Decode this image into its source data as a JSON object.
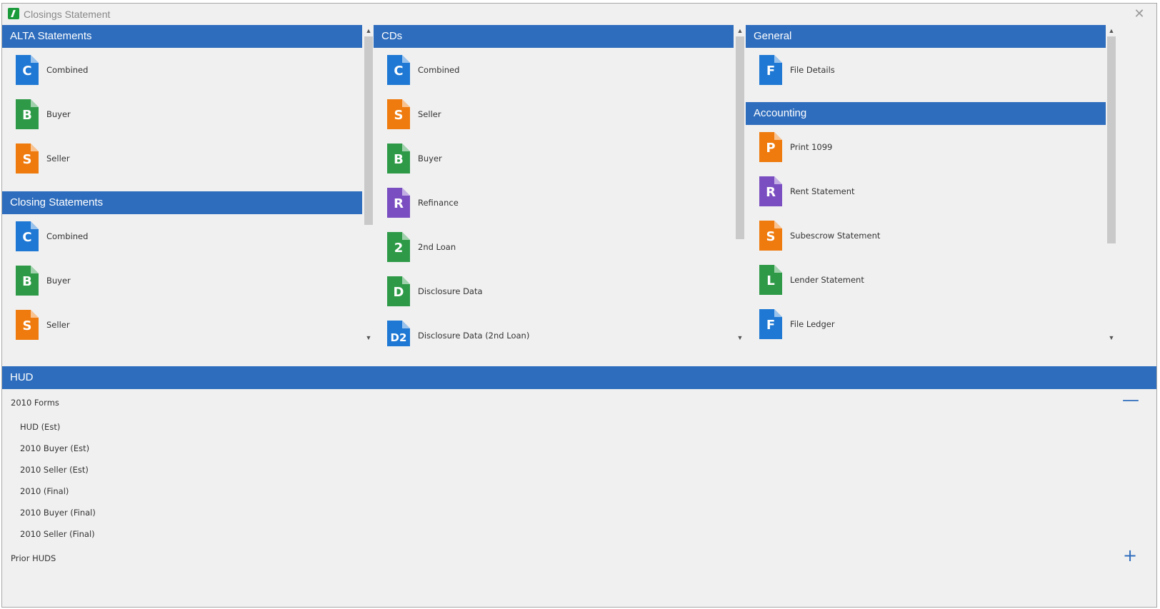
{
  "window": {
    "title": "Closings Statement",
    "close_glyph": "✕"
  },
  "colors": {
    "header_blue": "#2e6dbd",
    "doc_blue": "#1e78d4",
    "doc_green": "#2e9a48",
    "doc_orange": "#ef7a0d",
    "doc_purple": "#7a4ec0"
  },
  "panels": {
    "left": {
      "sections": [
        {
          "title": "ALTA Statements",
          "items": [
            {
              "letter": "C",
              "label": "Combined",
              "color": "#1e78d4"
            },
            {
              "letter": "B",
              "label": "Buyer",
              "color": "#2e9a48"
            },
            {
              "letter": "S",
              "label": "Seller",
              "color": "#ef7a0d"
            }
          ]
        },
        {
          "title": "Closing Statements",
          "items": [
            {
              "letter": "C",
              "label": "Combined",
              "color": "#1e78d4"
            },
            {
              "letter": "B",
              "label": "Buyer",
              "color": "#2e9a48"
            },
            {
              "letter": "S",
              "label": "Seller",
              "color": "#ef7a0d"
            }
          ]
        }
      ]
    },
    "middle": {
      "sections": [
        {
          "title": "CDs",
          "items": [
            {
              "letter": "C",
              "label": "Combined",
              "color": "#1e78d4"
            },
            {
              "letter": "S",
              "label": "Seller",
              "color": "#ef7a0d"
            },
            {
              "letter": "B",
              "label": "Buyer",
              "color": "#2e9a48"
            },
            {
              "letter": "R",
              "label": "Refinance",
              "color": "#7a4ec0"
            },
            {
              "letter": "2",
              "label": "2nd Loan",
              "color": "#2e9a48"
            },
            {
              "letter": "D",
              "label": "Disclosure Data",
              "color": "#2e9a48"
            },
            {
              "letter": "D2",
              "label": "Disclosure Data (2nd Loan)",
              "color": "#1e78d4"
            }
          ]
        }
      ]
    },
    "right": {
      "sections": [
        {
          "title": "General",
          "items": [
            {
              "letter": "F",
              "label": "File Details",
              "color": "#1e78d4"
            }
          ]
        },
        {
          "title": "Accounting",
          "items": [
            {
              "letter": "P",
              "label": "Print 1099",
              "color": "#ef7a0d"
            },
            {
              "letter": "R",
              "label": "Rent Statement",
              "color": "#7a4ec0"
            },
            {
              "letter": "S",
              "label": "Subescrow Statement",
              "color": "#ef7a0d"
            },
            {
              "letter": "L",
              "label": "Lender Statement",
              "color": "#2e9a48"
            },
            {
              "letter": "F",
              "label": "File Ledger",
              "color": "#1e78d4"
            }
          ]
        }
      ]
    }
  },
  "scroll_arrows": {
    "up": "▲",
    "down": "▼"
  },
  "hud": {
    "title": "HUD",
    "groups": [
      {
        "label": "2010 Forms",
        "toggle": "—",
        "expanded": true,
        "items": [
          "HUD (Est)",
          "2010 Buyer (Est)",
          "2010 Seller (Est)",
          "2010 (Final)",
          "2010 Buyer (Final)",
          "2010 Seller (Final)"
        ]
      },
      {
        "label": "Prior HUDS",
        "toggle": "+",
        "expanded": false,
        "items": []
      }
    ]
  }
}
